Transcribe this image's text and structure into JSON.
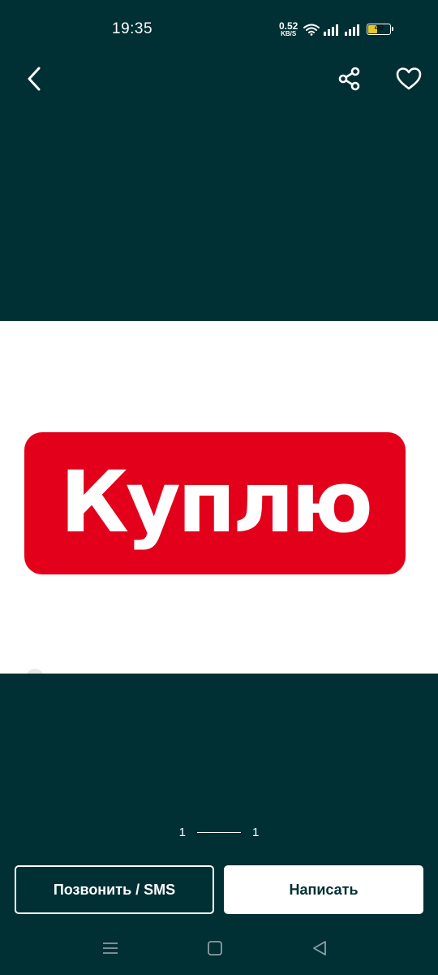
{
  "status_bar": {
    "time": "19:35",
    "net_speed_value": "0.52",
    "net_speed_unit": "KB/S",
    "battery_level": "40"
  },
  "gallery": {
    "image_text": "Куплю",
    "pager_current": "1",
    "pager_total": "1"
  },
  "actions": {
    "call_label": "Позвонить / SMS",
    "write_label": "Написать"
  },
  "icons": {
    "back": "chevron-left-icon",
    "share": "share-icon",
    "favorite": "heart-icon",
    "wifi": "wifi-icon",
    "signal": "signal-icon",
    "battery": "battery-icon",
    "menu": "menu-icon",
    "home": "home-icon",
    "back_nav": "back-triangle-icon"
  },
  "colors": {
    "background": "#002f34",
    "banner_red": "#e3001b",
    "battery_fill": "#e6c928",
    "button_text_dark": "#002f34"
  }
}
